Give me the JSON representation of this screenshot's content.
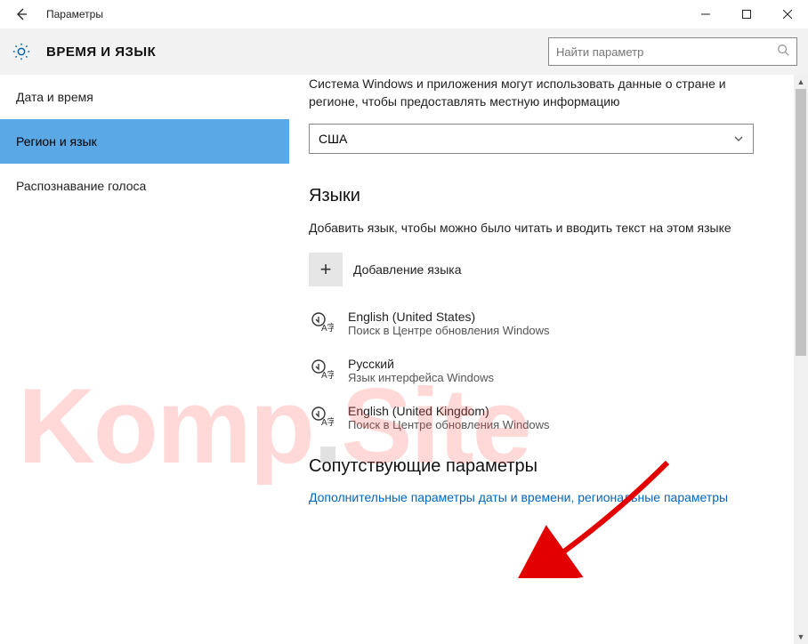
{
  "window": {
    "title": "Параметры"
  },
  "header": {
    "crumb": "ВРЕМЯ И ЯЗЫК",
    "search_placeholder": "Найти параметр"
  },
  "sidebar": {
    "items": [
      {
        "label": "Дата и время"
      },
      {
        "label": "Регион и язык"
      },
      {
        "label": "Распознавание голоса"
      }
    ],
    "selected_index": 1
  },
  "main": {
    "region_desc": "Система Windows и приложения могут использовать данные о стране и регионе, чтобы предоставлять местную информацию",
    "country_selected": "США",
    "languages_heading": "Языки",
    "languages_sub": "Добавить язык, чтобы можно было читать и вводить текст на этом языке",
    "add_language_label": "Добавление языка",
    "languages": [
      {
        "name": "English (United States)",
        "sub": "Поиск в Центре обновления Windows"
      },
      {
        "name": "Русский",
        "sub": "Язык интерфейса Windows"
      },
      {
        "name": "English (United Kingdom)",
        "sub": "Поиск в Центре обновления Windows"
      }
    ],
    "related_heading": "Сопутствующие параметры",
    "related_link": "Дополнительные параметры даты и времени, региональные параметры"
  },
  "watermark": {
    "part1": "Komp",
    "dot": ".",
    "part2": "Site"
  }
}
